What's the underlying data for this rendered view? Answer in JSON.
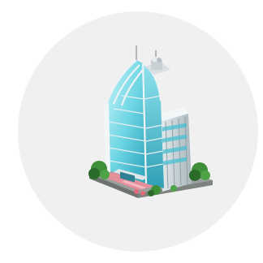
{
  "app_icon": {
    "subject": "skyscraper",
    "colors": {
      "background": "#ffffff",
      "disc": "#f0f0f0",
      "glass_light": "#9fe8f2",
      "glass_mid": "#48c4d6",
      "glass_dark": "#1e8fa6",
      "frame": "#e9eef1",
      "shadow_side": "#b9c4ca",
      "plaza": "#e58f9a",
      "base": "#8a8f8c",
      "tree": "#3f8f3a",
      "tree_dark": "#2b6b2a"
    }
  }
}
